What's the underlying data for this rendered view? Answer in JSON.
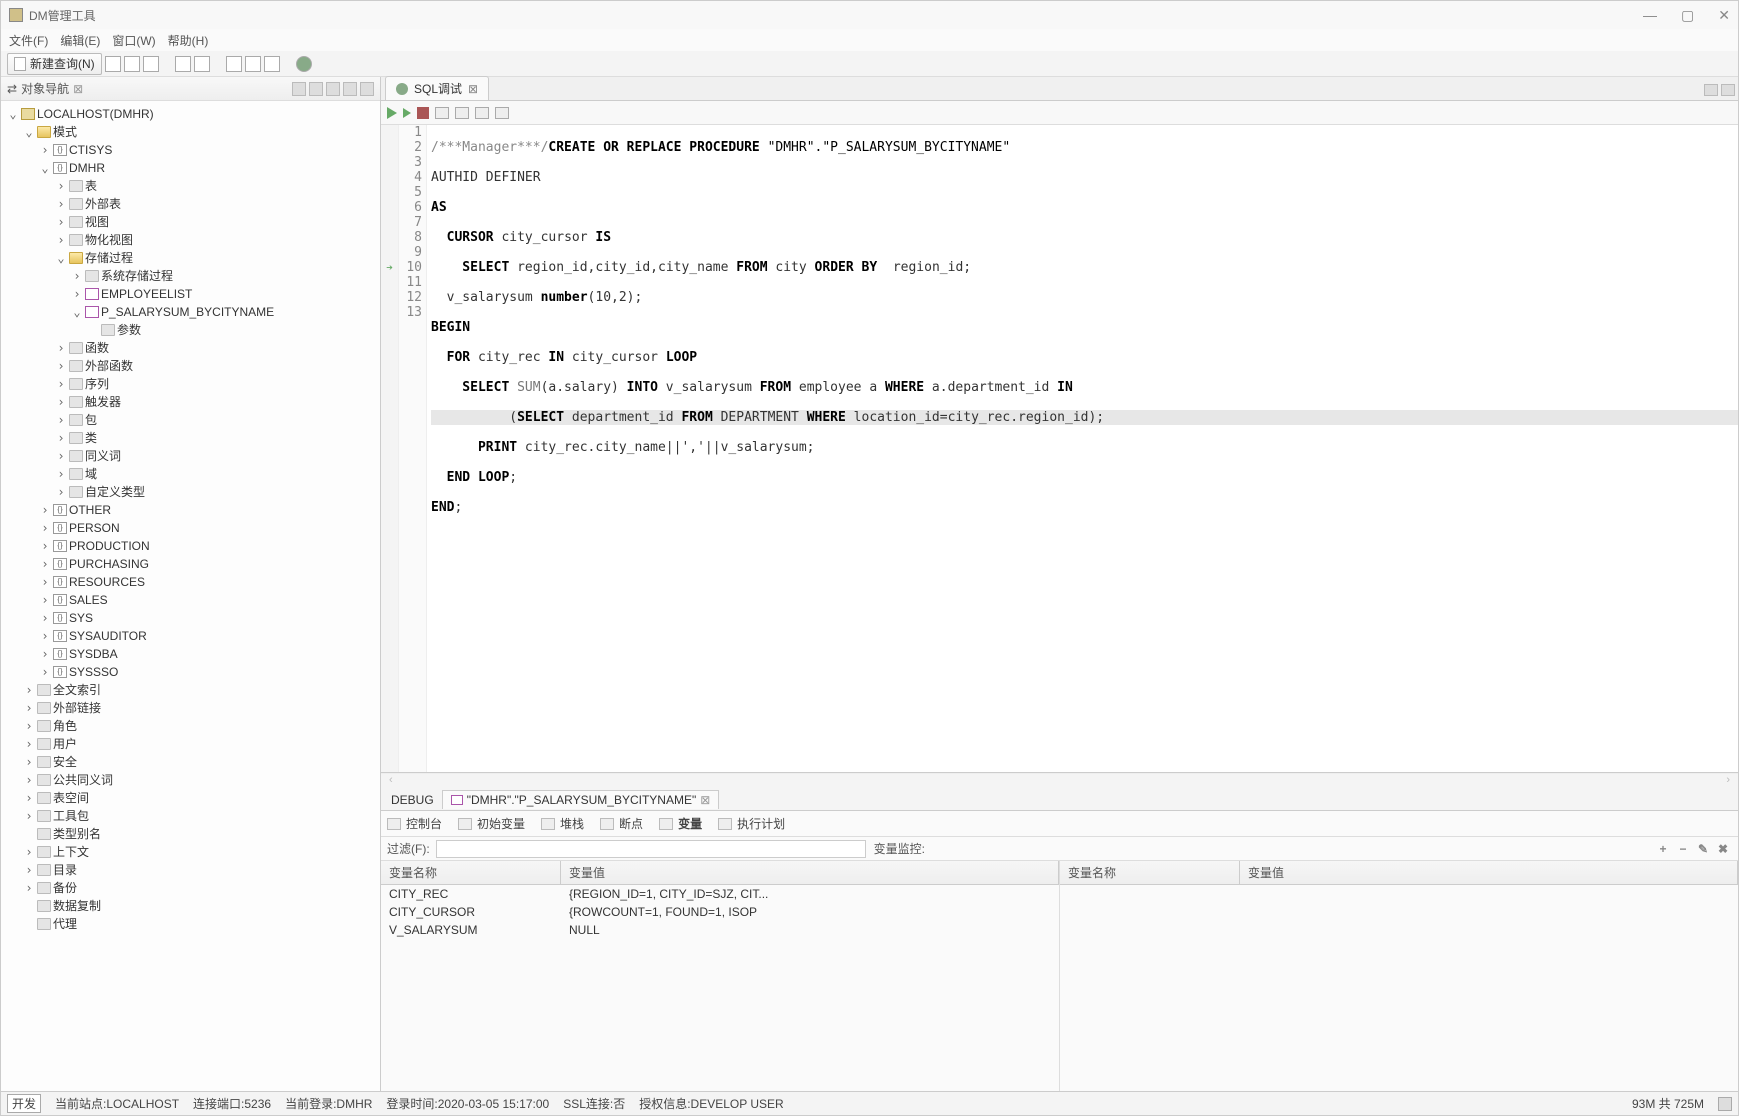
{
  "app": {
    "title": "DM管理工具"
  },
  "menu": {
    "file": "文件(F)",
    "edit": "编辑(E)",
    "window": "窗口(W)",
    "help": "帮助(H)"
  },
  "toolbar": {
    "new_query": "新建查询(N)"
  },
  "left_panel": {
    "title": "对象导航",
    "root": "LOCALHOST(DMHR)",
    "mode": "模式",
    "schemas": {
      "ctisys": "CTISYS",
      "dmhr": "DMHR",
      "other": "OTHER",
      "person": "PERSON",
      "production": "PRODUCTION",
      "purchasing": "PURCHASING",
      "resources": "RESOURCES",
      "sales": "SALES",
      "sys": "SYS",
      "sysauditor": "SYSAUDITOR",
      "sysdba": "SYSDBA",
      "syssso": "SYSSSO"
    },
    "dmhr_children": {
      "table": "表",
      "ext_table": "外部表",
      "view": "视图",
      "mat_view": "物化视图",
      "stored_proc": "存储过程",
      "sys_proc": "系统存储过程",
      "employeelist": "EMPLOYEELIST",
      "p_salary": "P_SALARYSUM_BYCITYNAME",
      "params": "参数",
      "function": "函数",
      "ext_function": "外部函数",
      "sequence": "序列",
      "trigger": "触发器",
      "package": "包",
      "class": "类",
      "synonym": "同义词",
      "domain": "域",
      "custom_type": "自定义类型"
    },
    "other_nodes": {
      "fulltext": "全文索引",
      "ext_link": "外部链接",
      "role": "角色",
      "user": "用户",
      "security": "安全",
      "public_syn": "公共同义词",
      "tablespace": "表空间",
      "toolkit": "工具包",
      "type_alias": "类型别名",
      "context": "上下文",
      "directory": "目录",
      "backup": "备份",
      "data_repl": "数据复制",
      "agent": "代理"
    }
  },
  "editor_tab": {
    "title": "SQL调试"
  },
  "code": {
    "l1a": "/***Manager***/",
    "l1b": "CREATE OR REPLACE PROCEDURE",
    "l1c": "\"DMHR\".\"P_SALARYSUM_BYCITYNAME\"",
    "l2": "AUTHID DEFINER",
    "l3": "AS",
    "l4a": "  CURSOR",
    "l4b": " city_cursor ",
    "l4c": "IS",
    "l5a": "    SELECT",
    "l5b": " region_id,city_id,city_name ",
    "l5c": "FROM",
    "l5d": " city ",
    "l5e": "ORDER BY",
    "l5f": "  region_id;",
    "l6a": "  v_salarysum ",
    "l6b": "number",
    "l6c": "(10,2);",
    "l7": "BEGIN",
    "l8a": "  FOR",
    "l8b": " city_rec ",
    "l8c": "IN",
    "l8d": " city_cursor ",
    "l8e": "LOOP",
    "l9a": "    SELECT ",
    "l9b": "SUM",
    "l9c": "(a.salary) ",
    "l9d": "INTO",
    "l9e": " v_salarysum ",
    "l9f": "FROM",
    "l9g": " employee a ",
    "l9h": "WHERE",
    "l9i": " a.department_id ",
    "l9j": "IN",
    "l10a": "          (",
    "l10b": "SELECT",
    "l10c": " department_id ",
    "l10d": "FROM",
    "l10e": " DEPARTMENT ",
    "l10f": "WHERE",
    "l10g": " location_id=city_rec.region_id);",
    "l11a": "      PRINT",
    "l11b": " city_rec.city_name||','||v_salarysum;",
    "l12a": "  END LOOP",
    "l12b": ";",
    "l13a": "END",
    "l13b": ";"
  },
  "line_numbers": [
    "1",
    "2",
    "3",
    "4",
    "5",
    "6",
    "7",
    "8",
    "9",
    "10",
    "11",
    "12",
    "13"
  ],
  "bottom": {
    "debug_label": "DEBUG",
    "debug_tab": "\"DMHR\".\"P_SALARYSUM_BYCITYNAME\"",
    "tabs": {
      "console": "控制台",
      "init_vars": "初始变量",
      "stack": "堆栈",
      "breakpoints": "断点",
      "variables": "变量",
      "exec_plan": "执行计划"
    },
    "filter_label": "过滤(F):",
    "monitor_label": "变量监控:",
    "col_name": "变量名称",
    "col_value": "变量值",
    "rows": [
      {
        "name": "CITY_REC",
        "value": "{REGION_ID=1, CITY_ID=SJZ, CIT..."
      },
      {
        "name": "CITY_CURSOR",
        "value": "{ROWCOUNT=1, FOUND=1, ISOP"
      },
      {
        "name": "V_SALARYSUM",
        "value": "NULL"
      }
    ]
  },
  "status": {
    "badge": "开发",
    "site": "当前站点:LOCALHOST",
    "port": "连接端口:5236",
    "login": "当前登录:DMHR",
    "login_time": "登录时间:2020-03-05 15:17:00",
    "ssl": "SSL连接:否",
    "auth": "授权信息:DEVELOP USER",
    "mem": "93M 共 725M"
  }
}
